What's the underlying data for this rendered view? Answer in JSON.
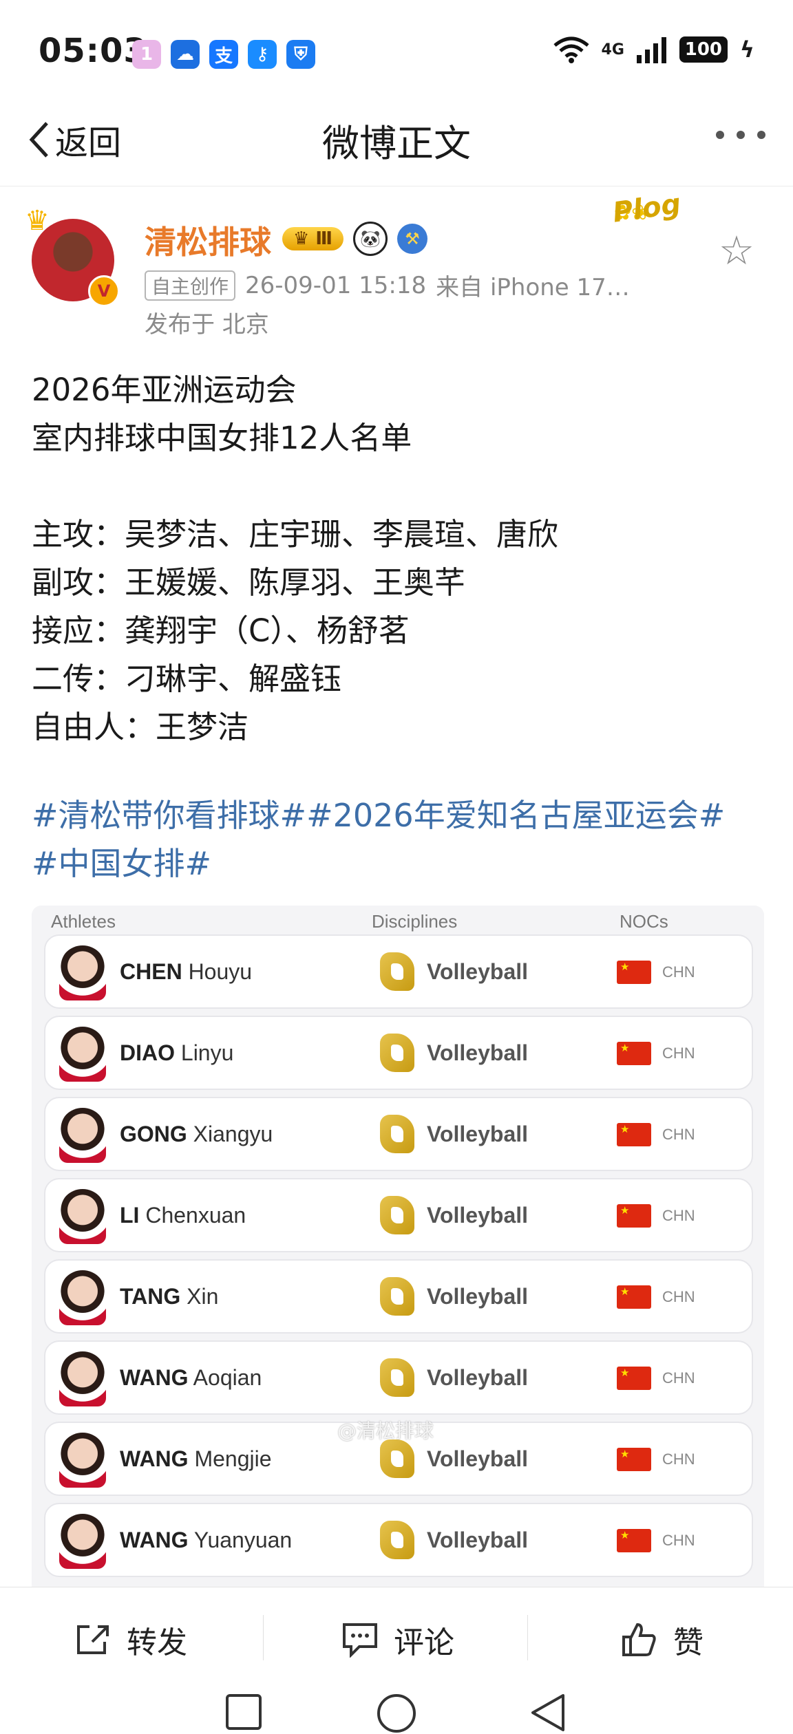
{
  "status_bar": {
    "time": "05:03",
    "app_icons": [
      {
        "name": "calendar-app-icon",
        "glyph": "1",
        "color": "#e9b6e8"
      },
      {
        "name": "cloud-app-icon",
        "glyph": "☁",
        "color": "#1d6fe0"
      },
      {
        "name": "alipay-app-icon",
        "glyph": "支",
        "color": "#1677ff"
      },
      {
        "name": "key-app-icon",
        "glyph": "⚷",
        "color": "#1a8cff"
      },
      {
        "name": "shield-app-icon",
        "glyph": "⛨",
        "color": "#1b7cf2"
      }
    ],
    "network": "4G",
    "battery": "100"
  },
  "nav": {
    "back_label": "返回",
    "title": "微博正文"
  },
  "post": {
    "username": "清松排球",
    "vip_level": "Ⅲ",
    "source_tag": "自主创作",
    "timestamp": "26-09-01 15:18",
    "source": "来自 iPhone 17…",
    "location": "发布于 北京",
    "sticker_text": "Plog",
    "lines": [
      "2026年亚洲运动会",
      "室内排球中国女排12人名单",
      "",
      "主攻：吴梦洁、庄宇珊、李晨瑄、唐欣",
      "副攻：王媛媛、陈厚羽、王奥芊",
      "接应：龚翔宇（C）、杨舒茗",
      "二传：刁琳宇、解盛钰",
      "自由人：王梦洁"
    ],
    "hashtags": [
      "#清松带你看排球#",
      "#2026年爱知名古屋亚运会#",
      "#中国女排#"
    ]
  },
  "roster_card": {
    "headers": {
      "athletes": "Athletes",
      "disciplines": "Disciplines",
      "nocs": "NOCs"
    },
    "rows": [
      {
        "family": "CHEN",
        "given": "Houyu",
        "discipline": "Volleyball",
        "noc": "CHN"
      },
      {
        "family": "DIAO",
        "given": "Linyu",
        "discipline": "Volleyball",
        "noc": "CHN"
      },
      {
        "family": "GONG",
        "given": "Xiangyu",
        "discipline": "Volleyball",
        "noc": "CHN"
      },
      {
        "family": "LI",
        "given": "Chenxuan",
        "discipline": "Volleyball",
        "noc": "CHN"
      },
      {
        "family": "TANG",
        "given": "Xin",
        "discipline": "Volleyball",
        "noc": "CHN"
      },
      {
        "family": "WANG",
        "given": "Aoqian",
        "discipline": "Volleyball",
        "noc": "CHN"
      },
      {
        "family": "WANG",
        "given": "Mengjie",
        "discipline": "Volleyball",
        "noc": "CHN"
      },
      {
        "family": "WANG",
        "given": "Yuanyuan",
        "discipline": "Volleyball",
        "noc": "CHN"
      }
    ],
    "watermark": "@清松排球"
  },
  "actions": {
    "repost": "转发",
    "comment": "评论",
    "like": "赞"
  }
}
